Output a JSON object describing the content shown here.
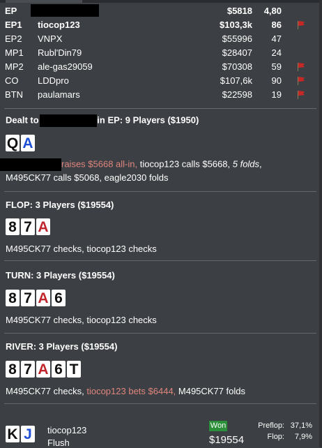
{
  "players": [
    {
      "pos": "EP",
      "name": "",
      "stack": "$5818",
      "bb": "4,80",
      "flag": false,
      "hero": true
    },
    {
      "pos": "EP1",
      "name": "tiocop123",
      "stack": "$103,3k",
      "bb": "86",
      "flag": true,
      "hero": true
    },
    {
      "pos": "EP2",
      "name": "VNPX",
      "stack": "$55996",
      "bb": "47",
      "flag": false,
      "hero": false
    },
    {
      "pos": "MP1",
      "name": "Rubl'Din79",
      "stack": "$28407",
      "bb": "24",
      "flag": false,
      "hero": false
    },
    {
      "pos": "MP2",
      "name": "ale-gas29059",
      "stack": "$70308",
      "bb": "59",
      "flag": true,
      "hero": false
    },
    {
      "pos": "CO",
      "name": "LDDpro",
      "stack": "$107,6k",
      "bb": "90",
      "flag": true,
      "hero": false
    },
    {
      "pos": "BTN",
      "name": "paulamars",
      "stack": "$22598",
      "bb": "19",
      "flag": true,
      "hero": false
    }
  ],
  "preflop": {
    "dealt_prefix": "Dealt to",
    "dealt_suffix": "in EP: 9 Players ($1950)",
    "hole_cards": [
      {
        "rank": "Q",
        "suit": "s"
      },
      {
        "rank": "A",
        "suit": "d"
      }
    ],
    "line1_raise": "raises $5668 all-in,",
    "line1_rest": " tiocop123 calls $5668, ",
    "line1_folds": "5 folds",
    "line1_end": ",",
    "line2": "M495CK77 calls $5068, eagle2030 folds"
  },
  "flop": {
    "title": "FLOP: 3 Players ($19554)",
    "cards": [
      {
        "rank": "8",
        "suit": "s"
      },
      {
        "rank": "7",
        "suit": "s"
      },
      {
        "rank": "A",
        "suit": "h"
      }
    ],
    "action": "M495CK77 checks, tiocop123 checks"
  },
  "turn": {
    "title": "TURN: 3 Players ($19554)",
    "cards": [
      {
        "rank": "8",
        "suit": "s"
      },
      {
        "rank": "7",
        "suit": "s"
      },
      {
        "rank": "A",
        "suit": "h"
      },
      {
        "rank": "6",
        "suit": "s"
      }
    ],
    "action": "M495CK77 checks, tiocop123 checks"
  },
  "river": {
    "title": "RIVER: 3 Players ($19554)",
    "cards": [
      {
        "rank": "8",
        "suit": "s"
      },
      {
        "rank": "7",
        "suit": "s"
      },
      {
        "rank": "A",
        "suit": "h"
      },
      {
        "rank": "6",
        "suit": "s"
      },
      {
        "rank": "T",
        "suit": "s"
      }
    ],
    "action_a": "M495CK77 checks, ",
    "action_bet": "tiocop123 bets $6444,",
    "action_b": " M495CK77 folds"
  },
  "result": {
    "cards": [
      {
        "rank": "K",
        "suit": "s"
      },
      {
        "rank": "J",
        "suit": "d"
      }
    ],
    "name": "tiocop123",
    "hand": "Flush",
    "won_label": "Won",
    "pot": "$19554",
    "equity": [
      {
        "street": "Preflop:",
        "value": "37,1%"
      },
      {
        "street": "Flop:",
        "value": "7,9%"
      }
    ]
  }
}
